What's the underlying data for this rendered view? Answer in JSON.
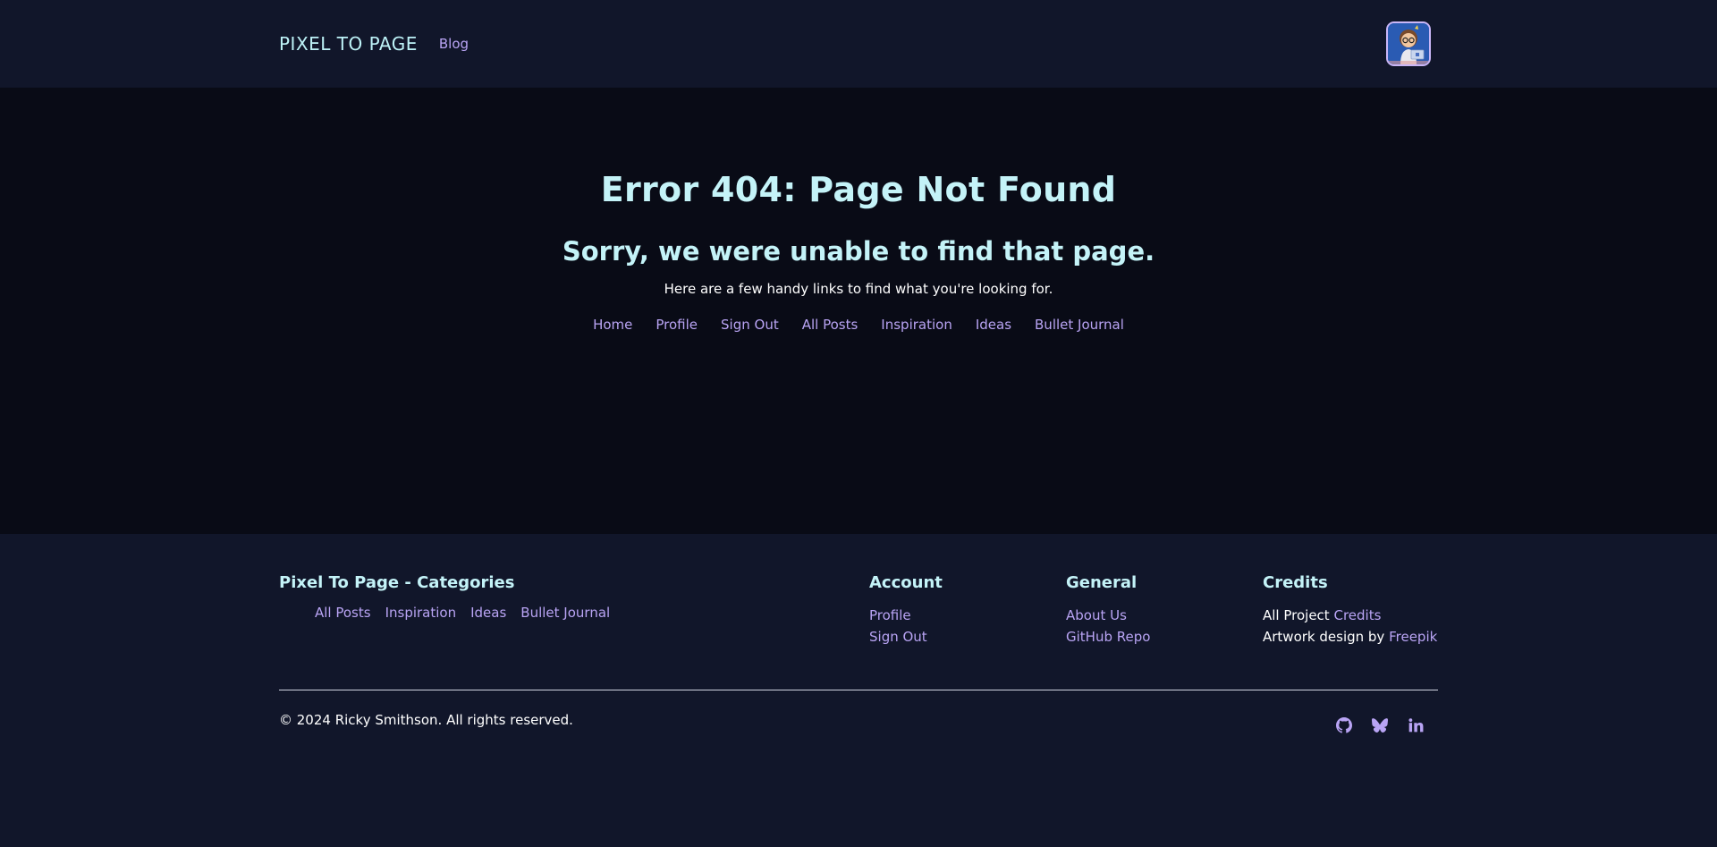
{
  "header": {
    "brand": "PIXEL TO PAGE",
    "nav_blog": "Blog"
  },
  "main": {
    "title": "Error 404: Page Not Found",
    "subtitle": "Sorry, we were unable to find that page.",
    "help": "Here are a few handy links to find what you're looking for.",
    "links": [
      "Home",
      "Profile",
      "Sign Out",
      "All Posts",
      "Inspiration",
      "Ideas",
      "Bullet Journal"
    ]
  },
  "footer": {
    "categories": {
      "heading": "Pixel To Page - Categories",
      "links": [
        "All Posts",
        "Inspiration",
        "Ideas",
        "Bullet Journal"
      ]
    },
    "account": {
      "heading": "Account",
      "links": [
        "Profile",
        "Sign Out"
      ]
    },
    "general": {
      "heading": "General",
      "links": [
        "About Us",
        "GitHub Repo"
      ]
    },
    "credits": {
      "heading": "Credits",
      "line1_prefix": "All Project",
      "line1_link": "Credits",
      "line2_prefix": "Artwork design by",
      "line2_link": "Freepik"
    },
    "copyright": "© 2024 Ricky Smithson. All rights reserved.",
    "social_icons": [
      "github-icon",
      "bluesky-icon",
      "linkedin-icon"
    ]
  },
  "colors": {
    "background_dark": "#090b16",
    "background_panel": "#11162a",
    "heading_cyan": "#c4f3f8",
    "link_purple": "#b9a4f4"
  }
}
